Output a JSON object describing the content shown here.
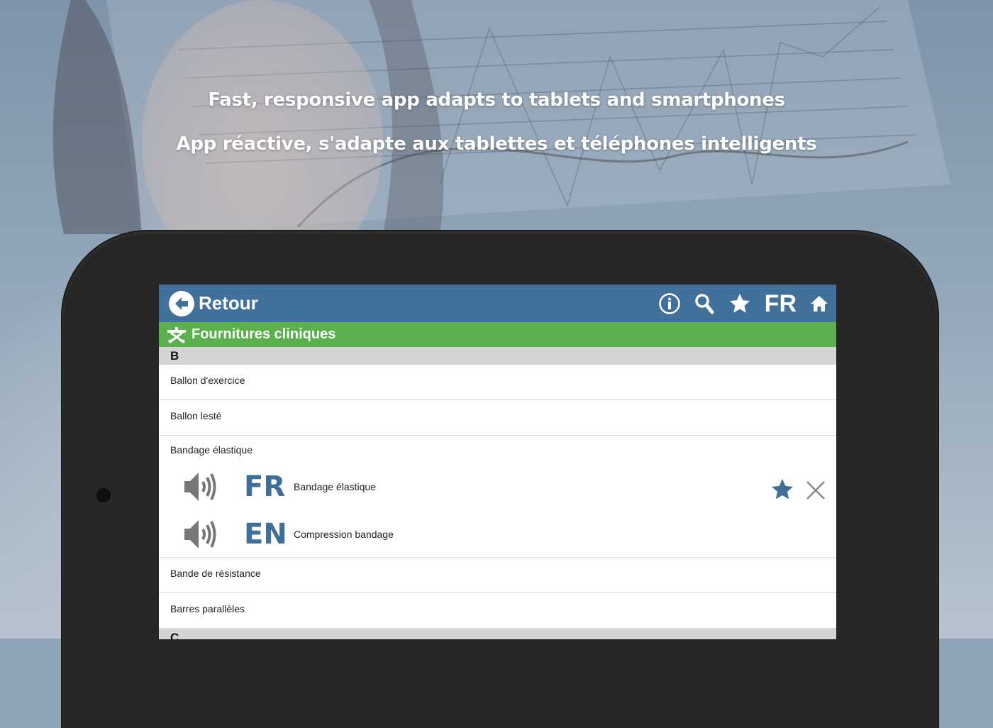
{
  "headline": {
    "english": "Fast, responsive app adapts to tablets and smartphones",
    "french": "App réactive, s'adapte aux tablettes et téléphones intelligents"
  },
  "appbar": {
    "back_label": "Retour",
    "language_label": "FR",
    "icons": [
      "info-icon",
      "search-icon",
      "star-icon",
      "home-icon"
    ],
    "color": "#41709a"
  },
  "category": {
    "title": "Fournitures cliniques",
    "color": "#5bb04e"
  },
  "list": {
    "section_b": "B",
    "items": [
      "Ballon d'exercice",
      "Ballon lesté",
      "Bandage élastique",
      "Bande de résistance",
      "Barres parallèles"
    ],
    "expanded": {
      "fr_label": "FR",
      "fr_term": "Bandage élastique",
      "en_label": "EN",
      "en_term": "Compression bandage"
    },
    "section_c": "C"
  }
}
